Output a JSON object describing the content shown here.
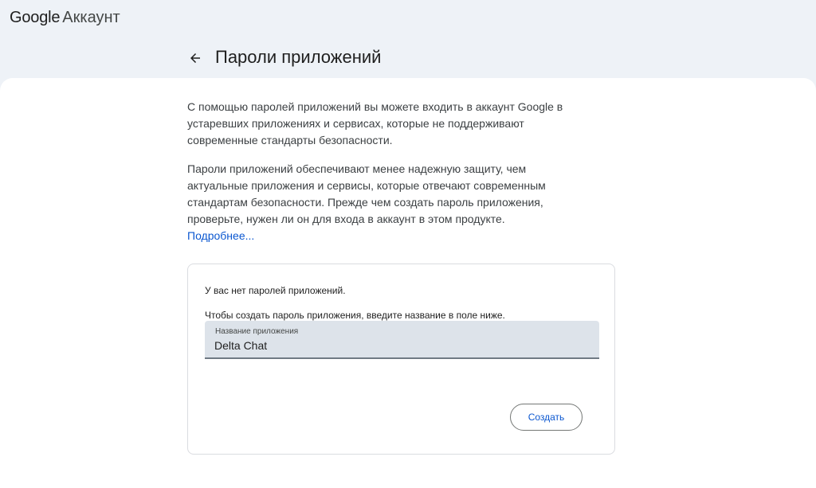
{
  "header": {
    "brand_google": "Google",
    "brand_account": "Аккаунт",
    "page_title": "Пароли приложений",
    "back_icon": "arrow-back-icon"
  },
  "intro": {
    "paragraph1": "С помощью паролей приложений вы можете входить в аккаунт Google в устаревших приложениях и сервисах, которые не поддерживают современные стандарты безопасности.",
    "paragraph2": "Пароли приложений обеспечивают менее надежную защиту, чем актуальные приложения и сервисы, которые отвечают современным стандартам безопасности. Прежде чем создать пароль приложения, проверьте, нужен ли он для входа в аккаунт в этом продукте.",
    "learn_more": "Подробнее..."
  },
  "card": {
    "no_passwords": "У вас нет паролей приложений.",
    "instruction": "Чтобы создать пароль приложения, введите название в поле ниже.",
    "field_label": "Название приложения",
    "field_value": "Delta Chat",
    "create_button": "Создать"
  },
  "colors": {
    "page_bg": "#eef2f7",
    "content_bg": "#ffffff",
    "link": "#0b57d0",
    "field_bg": "#dde3ea"
  }
}
